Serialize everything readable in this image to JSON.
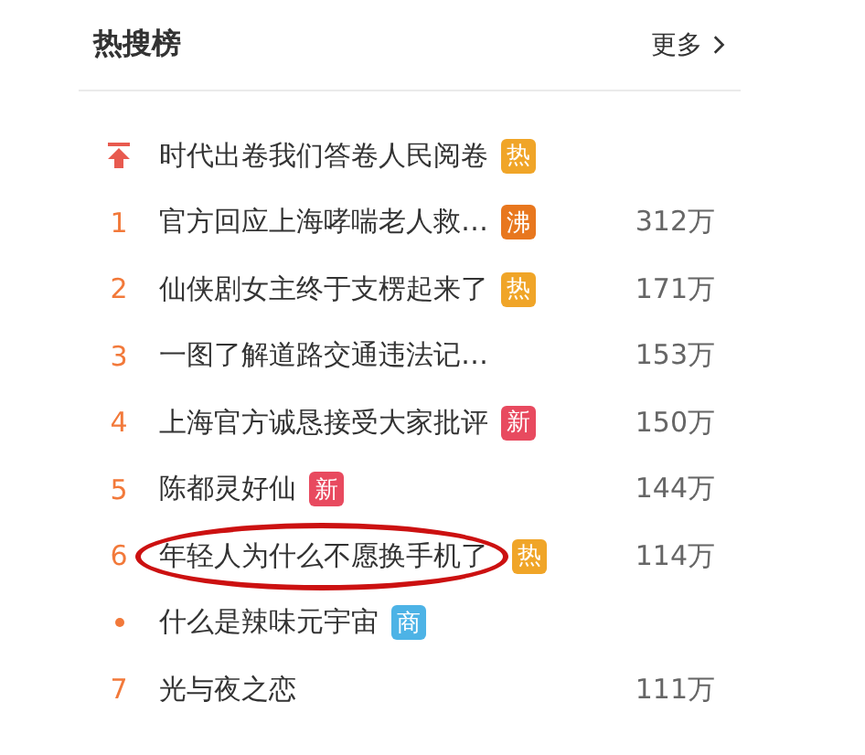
{
  "header": {
    "title": "热搜榜",
    "more_link": "更多"
  },
  "items": [
    {
      "kind": "pinned",
      "title": "时代出卷我们答卷人民阅卷",
      "badge": {
        "text": "热",
        "color": "#f0a528"
      },
      "circled": false
    },
    {
      "kind": "ranked",
      "rank": "1",
      "title": "官方回应上海哮喘老人救…",
      "badge": {
        "text": "沸",
        "color": "#e8771e"
      },
      "count": "312万",
      "circled": false
    },
    {
      "kind": "ranked",
      "rank": "2",
      "title": "仙侠剧女主终于支楞起来了",
      "badge": {
        "text": "热",
        "color": "#f0a528"
      },
      "count": "171万",
      "circled": false
    },
    {
      "kind": "ranked",
      "rank": "3",
      "title": "一图了解道路交通违法记…",
      "count": "153万",
      "circled": false
    },
    {
      "kind": "ranked",
      "rank": "4",
      "title": "上海官方诚恳接受大家批评",
      "badge": {
        "text": "新",
        "color": "#e84a5f"
      },
      "count": "150万",
      "circled": false
    },
    {
      "kind": "ranked",
      "rank": "5",
      "title": "陈都灵好仙",
      "badge": {
        "text": "新",
        "color": "#e84a5f"
      },
      "count": "144万",
      "circled": false
    },
    {
      "kind": "ranked",
      "rank": "6",
      "title": "年轻人为什么不愿换手机了",
      "badge": {
        "text": "热",
        "color": "#f0a528"
      },
      "count": "114万",
      "circled": true
    },
    {
      "kind": "promoted",
      "title": "什么是辣味元宇宙",
      "badge": {
        "text": "商",
        "color": "#4db3e6"
      },
      "circled": false
    },
    {
      "kind": "ranked",
      "rank": "7",
      "title": "光与夜之恋",
      "count": "111万",
      "circled": false
    }
  ]
}
